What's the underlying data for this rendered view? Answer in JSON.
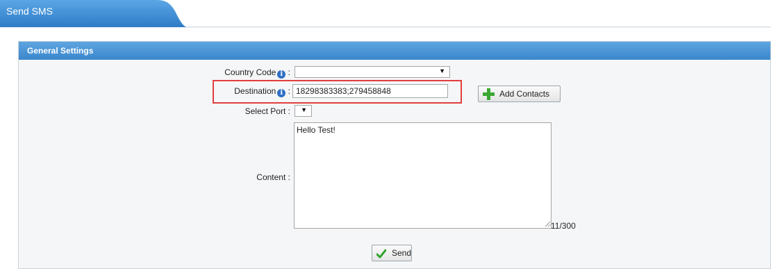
{
  "tab": {
    "title": "Send SMS"
  },
  "panel": {
    "title": "General Settings"
  },
  "form": {
    "country_code": {
      "label": "Country Code",
      "separator": ":",
      "value": ""
    },
    "destination": {
      "label": "Destination",
      "separator": ":",
      "value": "18298383383;279458848"
    },
    "add_contacts_label": "Add Contacts",
    "select_port": {
      "label": "Select Port",
      "separator": ":",
      "value": ""
    },
    "content": {
      "label": "Content",
      "separator": ":",
      "value": "Hello Test!"
    },
    "counter": "11/300",
    "send_label": "Send"
  },
  "icons": {
    "info": "info-icon",
    "add": "plus-icon",
    "send": "check-icon",
    "dropdown": "chevron-down-icon"
  },
  "colors": {
    "tab_blue": "#3f8fd6",
    "header_blue": "#3a86cc",
    "highlight_red": "#e23d3d",
    "plus_green": "#3aa832",
    "check_green": "#2fa12a"
  }
}
